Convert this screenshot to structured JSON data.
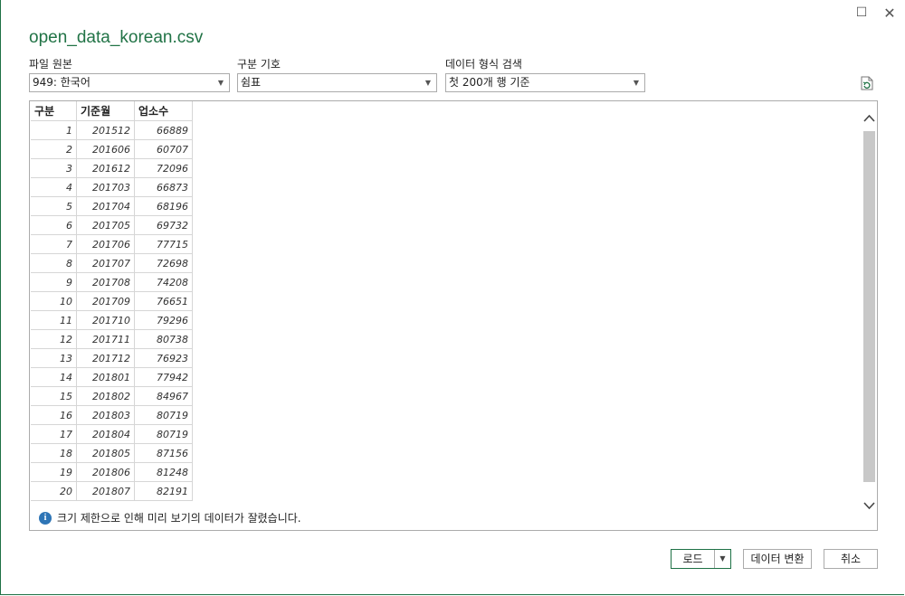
{
  "window": {
    "title": "open_data_korean.csv",
    "maximize_glyph": "☐",
    "close_glyph": "✕"
  },
  "options": {
    "file_origin": {
      "label": "파일 원본",
      "value": "949: 한국어"
    },
    "delimiter": {
      "label": "구분 기호",
      "value": "쉼표"
    },
    "type_detection": {
      "label": "데이터 형식 검색",
      "value": "첫 200개 행 기준"
    }
  },
  "table": {
    "headers": [
      "구분",
      "기준월",
      "업소수"
    ],
    "rows": [
      [
        "1",
        "201512",
        "66889"
      ],
      [
        "2",
        "201606",
        "60707"
      ],
      [
        "3",
        "201612",
        "72096"
      ],
      [
        "4",
        "201703",
        "66873"
      ],
      [
        "5",
        "201704",
        "68196"
      ],
      [
        "6",
        "201705",
        "69732"
      ],
      [
        "7",
        "201706",
        "77715"
      ],
      [
        "8",
        "201707",
        "72698"
      ],
      [
        "9",
        "201708",
        "74208"
      ],
      [
        "10",
        "201709",
        "76651"
      ],
      [
        "11",
        "201710",
        "79296"
      ],
      [
        "12",
        "201711",
        "80738"
      ],
      [
        "13",
        "201712",
        "76923"
      ],
      [
        "14",
        "201801",
        "77942"
      ],
      [
        "15",
        "201802",
        "84967"
      ],
      [
        "16",
        "201803",
        "80719"
      ],
      [
        "17",
        "201804",
        "80719"
      ],
      [
        "18",
        "201805",
        "87156"
      ],
      [
        "19",
        "201806",
        "81248"
      ],
      [
        "20",
        "201807",
        "82191"
      ]
    ]
  },
  "info_message": "크기 제한으로 인해 미리 보기의 데이터가 잘렸습니다.",
  "buttons": {
    "load": "로드",
    "transform": "데이터 변환",
    "cancel": "취소"
  },
  "colors": {
    "accent": "#217346",
    "info": "#2e75b6"
  },
  "icons": {
    "refresh": "refresh-icon",
    "info": "info-icon",
    "scroll_up": "chevron-up-icon",
    "scroll_down": "chevron-down-icon"
  }
}
